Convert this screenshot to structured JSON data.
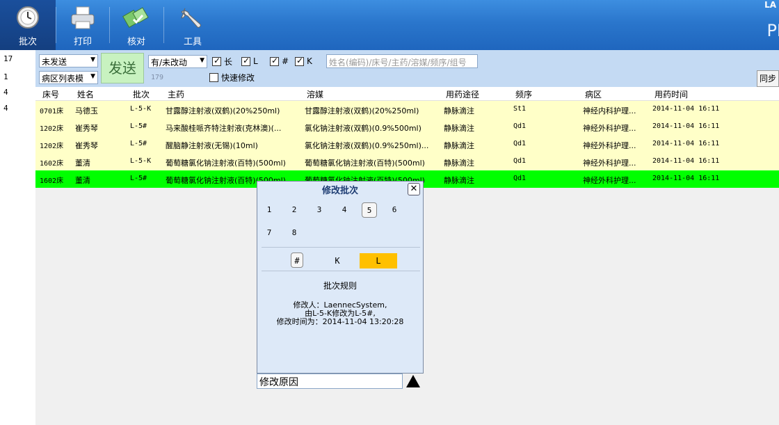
{
  "ribbon": {
    "buttons": [
      {
        "label": "批次",
        "icon": "clock-icon"
      },
      {
        "label": "打印",
        "icon": "printer-icon"
      },
      {
        "label": "核对",
        "icon": "check-icon"
      },
      {
        "label": "工具",
        "icon": "wrench-icon"
      }
    ],
    "brand_top": "LA",
    "brand_bottom": "PI"
  },
  "left_counts": [
    "17",
    "1",
    "4",
    "4"
  ],
  "filters": {
    "send_status": "未发送",
    "view_mode": "病区列表模",
    "send_button": "发送",
    "change_filter": "有/未改动",
    "checkboxes": [
      {
        "label": "长",
        "checked": true
      },
      {
        "label": "L",
        "checked": true
      },
      {
        "label": "#",
        "checked": true
      },
      {
        "label": "K",
        "checked": true
      }
    ],
    "quick_edit": {
      "label": "快速修改",
      "checked": false
    },
    "search_placeholder": "姓名(编码)/床号/主药/溶媒/频序/组号",
    "count": "179",
    "sync_button": "同步"
  },
  "table": {
    "headers": [
      "床号",
      "姓名",
      "批次",
      "主药",
      "溶媒",
      "用药途径",
      "频序",
      "病区",
      "用药时间"
    ],
    "rows": [
      {
        "bed": "0701床",
        "name": "马德玉",
        "batch": "L-5-K",
        "drug": "甘露醇注射液(双鹤)(20%250ml)",
        "solvent": "甘露醇注射液(双鹤)(20%250ml)",
        "route": "静脉滴注",
        "freq": "St1",
        "ward": "神经内科护理...",
        "time": "2014-11-04 16:11"
      },
      {
        "bed": "1202床",
        "name": "崔秀琴",
        "batch": "L-5#",
        "drug": "马来酸桂哌齐特注射液(克林澳)(...",
        "solvent": "氯化钠注射液(双鹤)(0.9%500ml)",
        "route": "静脉滴注",
        "freq": "Qd1",
        "ward": "神经外科护理...",
        "time": "2014-11-04 16:11"
      },
      {
        "bed": "1202床",
        "name": "崔秀琴",
        "batch": "L-5#",
        "drug": "醒脑静注射液(无锡)(10ml)",
        "solvent": "氯化钠注射液(双鹤)(0.9%250ml)...",
        "route": "静脉滴注",
        "freq": "Qd1",
        "ward": "神经外科护理...",
        "time": "2014-11-04 16:11"
      },
      {
        "bed": "1602床",
        "name": "董清",
        "batch": "L-5-K",
        "drug": "葡萄糖氯化钠注射液(百特)(500ml)",
        "solvent": "葡萄糖氯化钠注射液(百特)(500ml)",
        "route": "静脉滴注",
        "freq": "Qd1",
        "ward": "神经外科护理...",
        "time": "2014-11-04 16:11"
      },
      {
        "bed": "1602床",
        "name": "董清",
        "batch": "L-5#",
        "drug": "葡萄糖氯化钠注射液(百特)(500ml)",
        "solvent": "葡萄糖氯化钠注射液(百特)(500ml)",
        "route": "静脉滴注",
        "freq": "Qd1",
        "ward": "神经外科护理...",
        "time": "2014-11-04 16:11"
      }
    ],
    "selected_row": 4
  },
  "popup": {
    "title": "修改批次",
    "close": "✕",
    "numbers": [
      "1",
      "2",
      "3",
      "4",
      "5",
      "6",
      "7",
      "8"
    ],
    "selected_number": "5",
    "options": [
      "#",
      "K",
      "L"
    ],
    "selected_option": "L",
    "rule_title": "批次规则",
    "log_lines": [
      "修改人：LaennecSystem,",
      "由L-5-K修改为L-5#,",
      "修改时间为：2014-11-04 13:20:28"
    ],
    "reason_label": "修改原因"
  }
}
